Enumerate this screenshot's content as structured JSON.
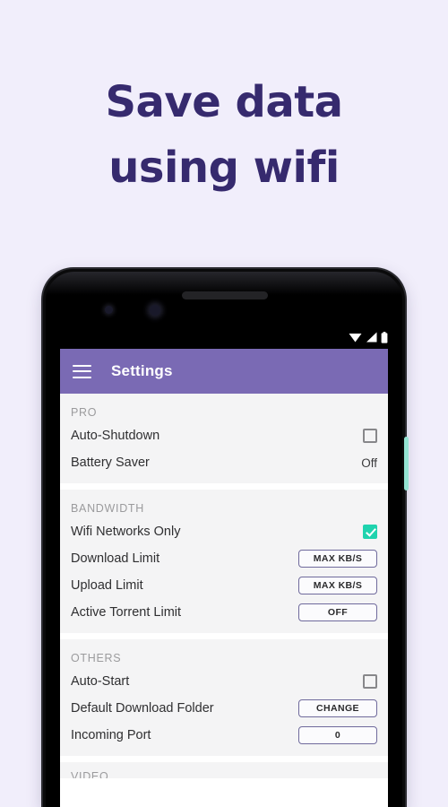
{
  "promo": {
    "line1": "Save data",
    "line2": "using wifi",
    "text_color": "#362a6e",
    "background_color": "#f1eefb"
  },
  "phone": {
    "side_button_color": "#93e3d2",
    "status_icons": [
      "wifi-icon",
      "signal-icon",
      "battery-icon"
    ]
  },
  "appbar": {
    "title": "Settings",
    "menu_icon": "hamburger-icon",
    "background_color": "#7a6ab4",
    "text_color": "#ffffff"
  },
  "settings": {
    "checkbox_checked_color": "#1fd3ae",
    "sections": [
      {
        "title": "PRO",
        "rows": [
          {
            "label": "Auto-Shutdown",
            "control": "checkbox",
            "checked": false
          },
          {
            "label": "Battery Saver",
            "control": "text",
            "value": "Off"
          }
        ]
      },
      {
        "title": "BANDWIDTH",
        "rows": [
          {
            "label": "Wifi Networks Only",
            "control": "checkbox",
            "checked": true
          },
          {
            "label": "Download Limit",
            "control": "button",
            "value": "MAX KB/S"
          },
          {
            "label": "Upload Limit",
            "control": "button",
            "value": "MAX KB/S"
          },
          {
            "label": "Active Torrent Limit",
            "control": "button",
            "value": "OFF"
          }
        ]
      },
      {
        "title": "OTHERS",
        "rows": [
          {
            "label": "Auto-Start",
            "control": "checkbox",
            "checked": false
          },
          {
            "label": "Default Download Folder",
            "control": "button",
            "value": "CHANGE"
          },
          {
            "label": "Incoming Port",
            "control": "button",
            "value": "0"
          }
        ]
      },
      {
        "title": "VIDEO",
        "rows": []
      }
    ]
  }
}
